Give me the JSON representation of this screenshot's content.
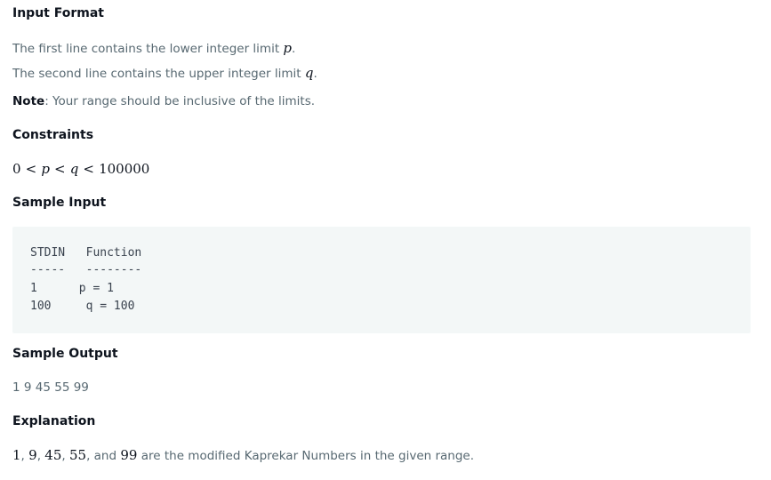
{
  "input_format": {
    "heading": "Input Format",
    "line1_prefix": "The first line contains the lower integer limit ",
    "line1_var": "p",
    "line1_suffix": ".",
    "line2_prefix": "The second line contains the upper integer limit ",
    "line2_var": "q",
    "line2_suffix": ".",
    "note_label": "Note",
    "note_text": ": Your range should be inclusive of the limits."
  },
  "constraints": {
    "heading": "Constraints",
    "expr_0": "0",
    "expr_lt1": "<",
    "expr_p": "p",
    "expr_lt2": "<",
    "expr_q": "q",
    "expr_lt3": "<",
    "expr_max": "100000"
  },
  "sample_input": {
    "heading": "Sample Input",
    "col_header": "STDIN   Function",
    "col_divider": "-----   --------",
    "row1": "1      p = 1",
    "row2": "100     q = 100"
  },
  "sample_output": {
    "heading": "Sample Output",
    "value": "1 9 45 55 99"
  },
  "explanation": {
    "heading": "Explanation",
    "n1": "1",
    "sep1": ", ",
    "n2": "9",
    "sep2": ", ",
    "n3": "45",
    "sep3": ", ",
    "n4": "55",
    "sep4": ", and ",
    "n5": "99",
    "tail": " are the modified Kaprekar Numbers in the given range."
  }
}
